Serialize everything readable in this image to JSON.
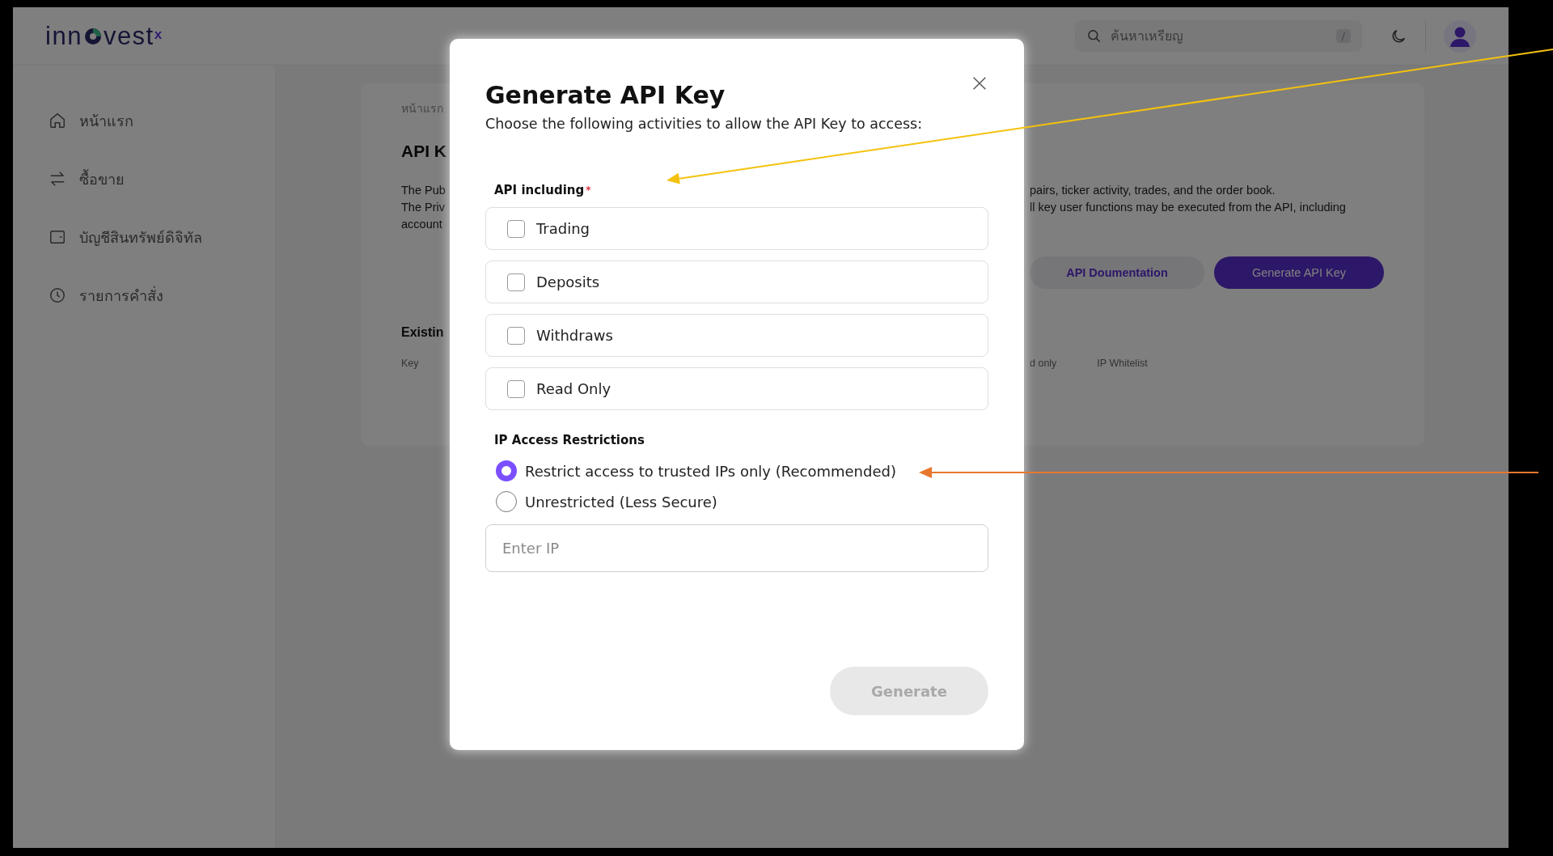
{
  "header": {
    "logo": {
      "text_before": "inn",
      "text_after": "vest",
      "superscript": "x"
    },
    "search": {
      "placeholder": "ค้นหาเหรียญ",
      "shortcut": "/"
    }
  },
  "sidebar": {
    "items": [
      {
        "label": "หน้าแรก"
      },
      {
        "label": "ซื้อขาย"
      },
      {
        "label": "บัญชีสินทรัพย์ดิจิทัล"
      },
      {
        "label": "รายการคำสั่ง"
      }
    ]
  },
  "main": {
    "breadcrumb": "หน้าแรก",
    "title": "API K",
    "description": [
      {
        "left": "The Pub",
        "right": "pairs, ticker activity, trades, and the order book."
      },
      {
        "left": "The Priv",
        "right": "ll key user functions may be executed from the API, including"
      },
      {
        "left": "account"
      }
    ],
    "buttons": [
      {
        "label": "API Doumentation",
        "kind": "secondary"
      },
      {
        "label": "Generate API Key",
        "kind": "primary"
      }
    ],
    "section_title": "Existin",
    "table": {
      "columns": [
        {
          "label": "Key"
        },
        {
          "label": "d only"
        },
        {
          "label": "IP Whitelist"
        }
      ]
    }
  },
  "modal": {
    "title": "Generate API Key",
    "subtitle": "Choose the following activities to allow the API Key to access:",
    "activities": {
      "label": "API including",
      "required_mark": "*",
      "options": [
        {
          "label": "Trading",
          "checked": false
        },
        {
          "label": "Deposits",
          "checked": false
        },
        {
          "label": "Withdraws",
          "checked": false
        },
        {
          "label": "Read Only",
          "checked": false
        }
      ]
    },
    "ip_access": {
      "label": "IP Access Restrictions",
      "options": [
        {
          "label": "Restrict access to trusted IPs only (Recommended)",
          "selected": true
        },
        {
          "label": "Unrestricted (Less Secure)",
          "selected": false
        }
      ],
      "ip_field": {
        "placeholder": "Enter IP"
      }
    },
    "submit": {
      "label": "Generate",
      "disabled": true
    }
  },
  "annotations": [
    {
      "kind": "arrow",
      "color": "#f4c20d"
    },
    {
      "kind": "arrow",
      "color": "#e8772e"
    }
  ]
}
